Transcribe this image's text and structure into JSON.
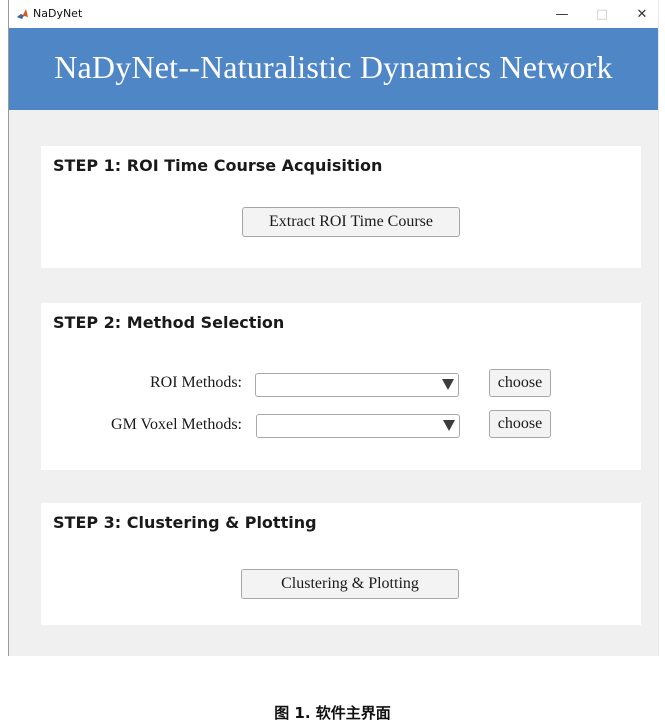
{
  "window": {
    "title": "NaDyNet",
    "minimize_glyph": "—",
    "maximize_glyph": "□",
    "close_glyph": "✕",
    "app_icon": "matlab-icon"
  },
  "banner": {
    "title": "NaDyNet--Naturalistic Dynamics Network",
    "background": "#4f86c6"
  },
  "step1": {
    "title": "STEP 1: ROI Time Course Acquisition",
    "button_label": "Extract ROI Time Course"
  },
  "step2": {
    "title": "STEP 2: Method Selection",
    "roi_label": "ROI Methods:",
    "roi_selected": "",
    "roi_choose": "choose",
    "gm_label": "GM Voxel Methods:",
    "gm_selected": "",
    "gm_choose": "choose"
  },
  "step3": {
    "title": "STEP 3:  Clustering & Plotting",
    "button_label": "Clustering & Plotting"
  },
  "caption": "图 1. 软件主界面"
}
